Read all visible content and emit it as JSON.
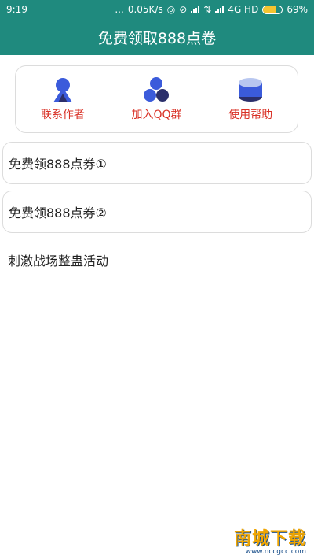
{
  "status_bar": {
    "time": "9:19",
    "dots": "...",
    "speed": "0.05K/s",
    "network": "4G HD",
    "battery": "69%",
    "battery_level": 0.69
  },
  "app_bar": {
    "title": "免费领取888点卷"
  },
  "quick_actions": [
    {
      "label": "联系作者",
      "icon": "person-icon"
    },
    {
      "label": "加入QQ群",
      "icon": "group-icon"
    },
    {
      "label": "使用帮助",
      "icon": "database-icon"
    }
  ],
  "cards": [
    {
      "label": "免费领888点券①"
    },
    {
      "label": "免费领888点券②"
    }
  ],
  "plain_items": [
    {
      "label": "刺激战场整蛊活动"
    }
  ],
  "watermark": {
    "title": "南城下载",
    "url": "www.nccgcc.com"
  },
  "colors": {
    "primary": "#1f8a7e",
    "accent_red": "#d93025",
    "icon_blue": "#3b5bdb",
    "icon_dark": "#2b2f6b"
  }
}
